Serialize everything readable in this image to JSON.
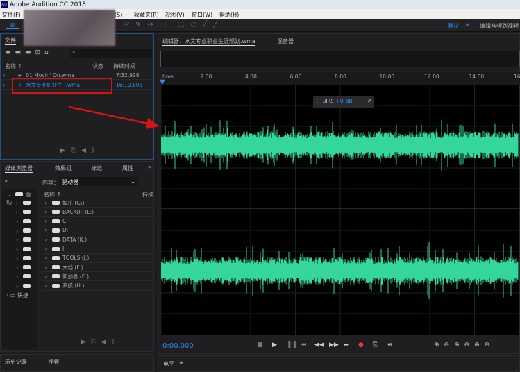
{
  "app_title": "Adobe Audition CC 2018",
  "menu": {
    "file": "文件(F)",
    "effects": "果(S)",
    "favorites": "收藏夹(R)",
    "view": "视图(V)",
    "window": "窗口(W)",
    "help": "帮助(H)"
  },
  "workspace": {
    "default": "默认",
    "edit_video": "编辑音频到视频"
  },
  "files_panel": {
    "tab": "文件",
    "columns": {
      "name": "名称 ↑",
      "status": "状态",
      "duration": "持续时间"
    },
    "files": [
      {
        "name": "01 Movin' On.wma",
        "duration": "7:32.928"
      },
      {
        "name": "水文专业职业生 ..wma",
        "duration": "16:19.603"
      }
    ]
  },
  "media_browser": {
    "tabs": [
      "媒体浏览器",
      "效果组",
      "标记",
      "属性"
    ],
    "content_label": "内容：",
    "content_value": "驱动器",
    "tree_root": "驱动",
    "quick": "快捷",
    "name_col": "名称 ↑",
    "duration_col": "持续",
    "drives": [
      "娱乐 (G:)",
      "BACKUP (L:)",
      "C:",
      "D:",
      "DATA (K:)",
      "I:",
      "TOOLS (J:)",
      "文档 (F:)",
      "新加卷 (E:)",
      "系统 (H:)"
    ]
  },
  "history": {
    "tabs": [
      "历史记录",
      "视频"
    ]
  },
  "editor": {
    "tab": "编辑器：水文专业职业生涯规划.wma",
    "mixer": "混音器",
    "ruler": [
      "hms",
      "2:00",
      "4:00",
      "6:00",
      "8:00",
      "10:00",
      "12:00",
      "14:00",
      "16:"
    ],
    "gain": "+0 dB",
    "time": "0:00.000"
  },
  "levels": {
    "title": "电平"
  },
  "colors": {
    "waveform": "#35d69b",
    "accent": "#2d8ceb",
    "highlight": "#d31515"
  }
}
